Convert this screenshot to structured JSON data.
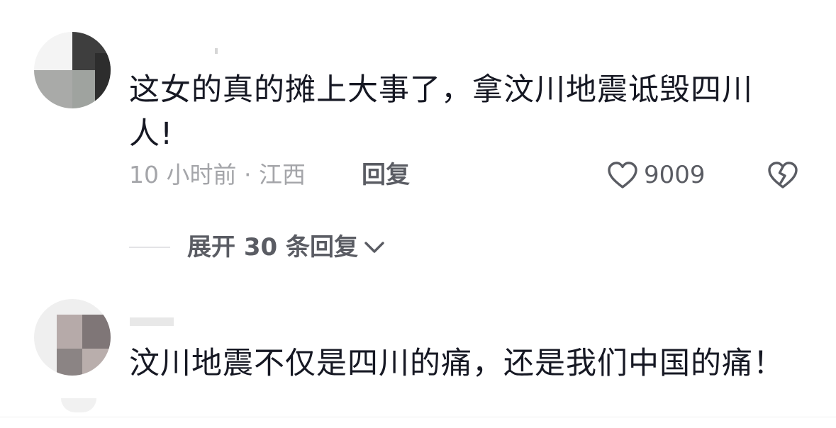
{
  "comments": [
    {
      "text": "这女的真的摊上大事了，拿汶川地震诋毁四川人!",
      "time_location": "10 小时前 · 江西",
      "reply_label": "回复",
      "like_count": "9009",
      "expand_replies_label": "展开 30 条回复"
    },
    {
      "text": "汶川地震不仅是四川的痛，还是我们中国的痛！"
    }
  ],
  "icons": {
    "like": "heart-outline-icon",
    "dislike": "broken-heart-icon",
    "expand": "chevron-down-icon"
  },
  "colors": {
    "text_primary": "#161823",
    "text_secondary": "#a4a5a9",
    "action": "#5a5c63"
  }
}
